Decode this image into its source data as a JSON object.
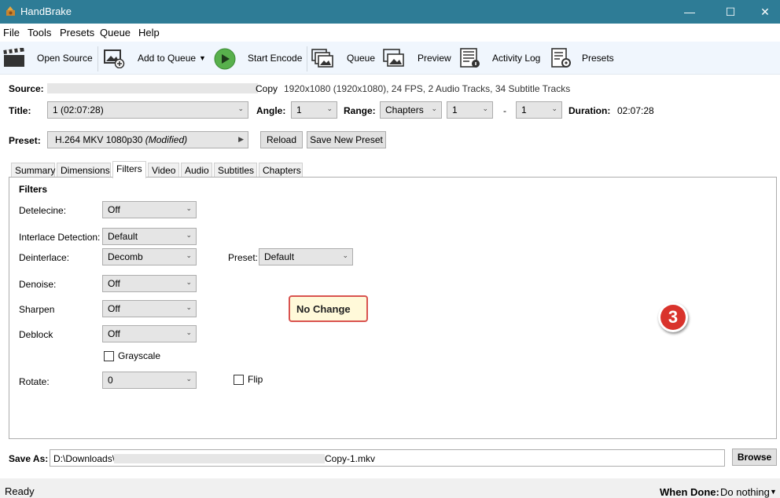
{
  "window": {
    "title": "HandBrake",
    "minimize_glyph": "—",
    "maximize_glyph": "☐",
    "close_glyph": "✕"
  },
  "menu": [
    "File",
    "Tools",
    "Presets",
    "Queue",
    "Help"
  ],
  "toolbar": {
    "open_source": "Open Source",
    "add_to_queue": "Add to Queue",
    "start_encode": "Start Encode",
    "queue": "Queue",
    "preview": "Preview",
    "activity_log": "Activity Log",
    "presets": "Presets"
  },
  "source": {
    "label": "Source:",
    "name_suffix": "Copy",
    "info": "1920x1080 (1920x1080), 24 FPS, 2 Audio Tracks, 34 Subtitle Tracks"
  },
  "title_row": {
    "title_label": "Title:",
    "title_value": "1 (02:07:28)",
    "angle_label": "Angle:",
    "angle_value": "1",
    "range_label": "Range:",
    "range_type": "Chapters",
    "range_start": "1",
    "range_dash": "-",
    "range_end": "1",
    "duration_label": "Duration:",
    "duration_value": "02:07:28"
  },
  "preset_row": {
    "label": "Preset:",
    "value": "H.264 MKV 1080p30",
    "modified": "(Modified)",
    "reload": "Reload",
    "save_new": "Save New Preset"
  },
  "tabs": [
    "Summary",
    "Dimensions",
    "Filters",
    "Video",
    "Audio",
    "Subtitles",
    "Chapters"
  ],
  "active_tab": "Filters",
  "filters": {
    "heading": "Filters",
    "detelecine_label": "Detelecine:",
    "detelecine_value": "Off",
    "interlace_label": "Interlace Detection:",
    "interlace_value": "Default",
    "deinterlace_label": "Deinterlace:",
    "deinterlace_value": "Decomb",
    "preset_label": "Preset:",
    "preset_value": "Default",
    "denoise_label": "Denoise:",
    "denoise_value": "Off",
    "sharpen_label": "Sharpen",
    "sharpen_value": "Off",
    "deblock_label": "Deblock",
    "deblock_value": "Off",
    "grayscale_label": "Grayscale",
    "rotate_label": "Rotate:",
    "rotate_value": "0",
    "flip_label": "Flip"
  },
  "callout": {
    "text": "No Change",
    "step_number": "3"
  },
  "save_as": {
    "label": "Save As:",
    "path_prefix": "D:\\Downloads\\",
    "path_suffix": "Copy-1.mkv",
    "browse": "Browse"
  },
  "status": {
    "text": "Ready",
    "when_done_label": "When Done:",
    "when_done_value": "Do nothing"
  },
  "colors": {
    "titlebar": "#2e7c96",
    "toolbar_bg": "#f0f6fd",
    "callout_border": "#d9534f",
    "callout_bg": "#fff9d9",
    "badge": "#d9332c",
    "play_green": "#4caf50"
  }
}
